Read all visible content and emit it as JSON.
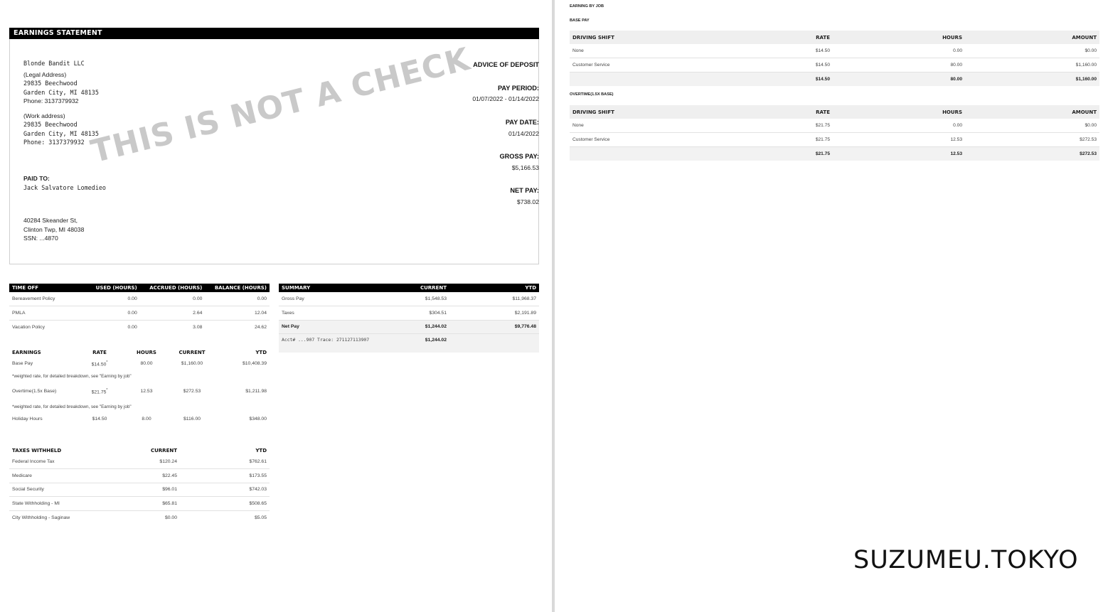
{
  "statement": {
    "header": "EARNINGS STATEMENT",
    "company": "Blonde Bandit LLC",
    "legal_label": "(Legal Address)",
    "legal_street": "29835 Beechwood",
    "legal_city": "Garden City, MI 48135",
    "legal_phone": "Phone: 3137379932",
    "work_label": "(Work address)",
    "work_street": "29835 Beechwood",
    "work_city": "Garden City, MI 48135",
    "work_phone": "Phone: 3137379932",
    "paid_to_label": "PAID TO:",
    "employee": "Jack Salvatore Lomedieo",
    "emp_street": "40284 Skeander St,",
    "emp_city": "Clinton Twp, MI 48038",
    "ssn": "SSN: ...4870",
    "watermark": "THIS IS NOT A CHECK",
    "advice": "ADVICE OF DEPOSIT",
    "pay_period_label": "PAY PERIOD:",
    "pay_period": "01/07/2022 - 01/14/2022",
    "pay_date_label": "PAY DATE:",
    "pay_date": "01/14/2022",
    "gross_pay_label": "GROSS PAY:",
    "gross_pay": "$5,166.53",
    "net_pay_label": "NET PAY:",
    "net_pay": "$738.02"
  },
  "time_off": {
    "headers": [
      "TIME OFF",
      "USED (HOURS)",
      "ACCRUED (HOURS)",
      "BALANCE (HOURS)"
    ],
    "rows": [
      [
        "Bereavement Policy",
        "0.00",
        "0.00",
        "0.00"
      ],
      [
        "PMLA",
        "0.00",
        "2.64",
        "12.04"
      ],
      [
        "Vacation Policy",
        "0.00",
        "3.08",
        "24.62"
      ]
    ]
  },
  "summary": {
    "headers": [
      "SUMMARY",
      "CURRENT",
      "YTD"
    ],
    "rows": [
      [
        "Gross Pay",
        "$1,548.53",
        "$11,968.37"
      ],
      [
        "Taxes",
        "$304.51",
        "$2,191.89"
      ],
      [
        "Net Pay",
        "$1,244.02",
        "$9,776.48"
      ]
    ],
    "acct": "Acct# ...907 Trace: 271127113907",
    "acct_amount": "$1,244.02"
  },
  "earnings": {
    "headers": [
      "EARNINGS",
      "RATE",
      "HOURS",
      "CURRENT",
      "YTD"
    ],
    "rows": [
      [
        "Base Pay",
        "$14.50",
        "80.00",
        "$1,160.00",
        "$10,408.39"
      ],
      [
        "Overtime(1.5x Base)",
        "$21.75",
        "12.53",
        "$272.53",
        "$1,211.98"
      ],
      [
        "Holiday Hours",
        "$14.50",
        "8.00",
        "$116.00",
        "$348.00"
      ]
    ],
    "asterisk": "*",
    "note": "*weighted rate, for detailed breakdown, see \"Earning by job\""
  },
  "taxes": {
    "headers": [
      "TAXES WITHHELD",
      "CURRENT",
      "YTD"
    ],
    "rows": [
      [
        "Federal Income Tax",
        "$120.24",
        "$762.61"
      ],
      [
        "Medicare",
        "$22.45",
        "$173.55"
      ],
      [
        "Social Security",
        "$96.01",
        "$742.03"
      ],
      [
        "State Withholding - MI",
        "$65.81",
        "$508.65"
      ],
      [
        "City Withholding - Saginaw",
        "$0.00",
        "$5.05"
      ]
    ]
  },
  "earning_by_job": {
    "title": "EARNING BY JOB",
    "base_label": "BASE PAY",
    "overtime_label": "OVERTIME(1.5X BASE)",
    "headers": [
      "DRIVING SHIFT",
      "RATE",
      "HOURS",
      "AMOUNT"
    ],
    "base_rows": [
      [
        "None",
        "$14.50",
        "0.00",
        "$0.00"
      ],
      [
        "Customer Service",
        "$14.50",
        "80.00",
        "$1,160.00"
      ]
    ],
    "base_total": [
      "",
      "$14.50",
      "80.00",
      "$1,160.00"
    ],
    "ot_rows": [
      [
        "None",
        "$21.75",
        "0.00",
        "$0.00"
      ],
      [
        "Customer Service",
        "$21.75",
        "12.53",
        "$272.53"
      ]
    ],
    "ot_total": [
      "",
      "$21.75",
      "12.53",
      "$272.53"
    ]
  },
  "brand": "SUZUMEU.TOKYO"
}
